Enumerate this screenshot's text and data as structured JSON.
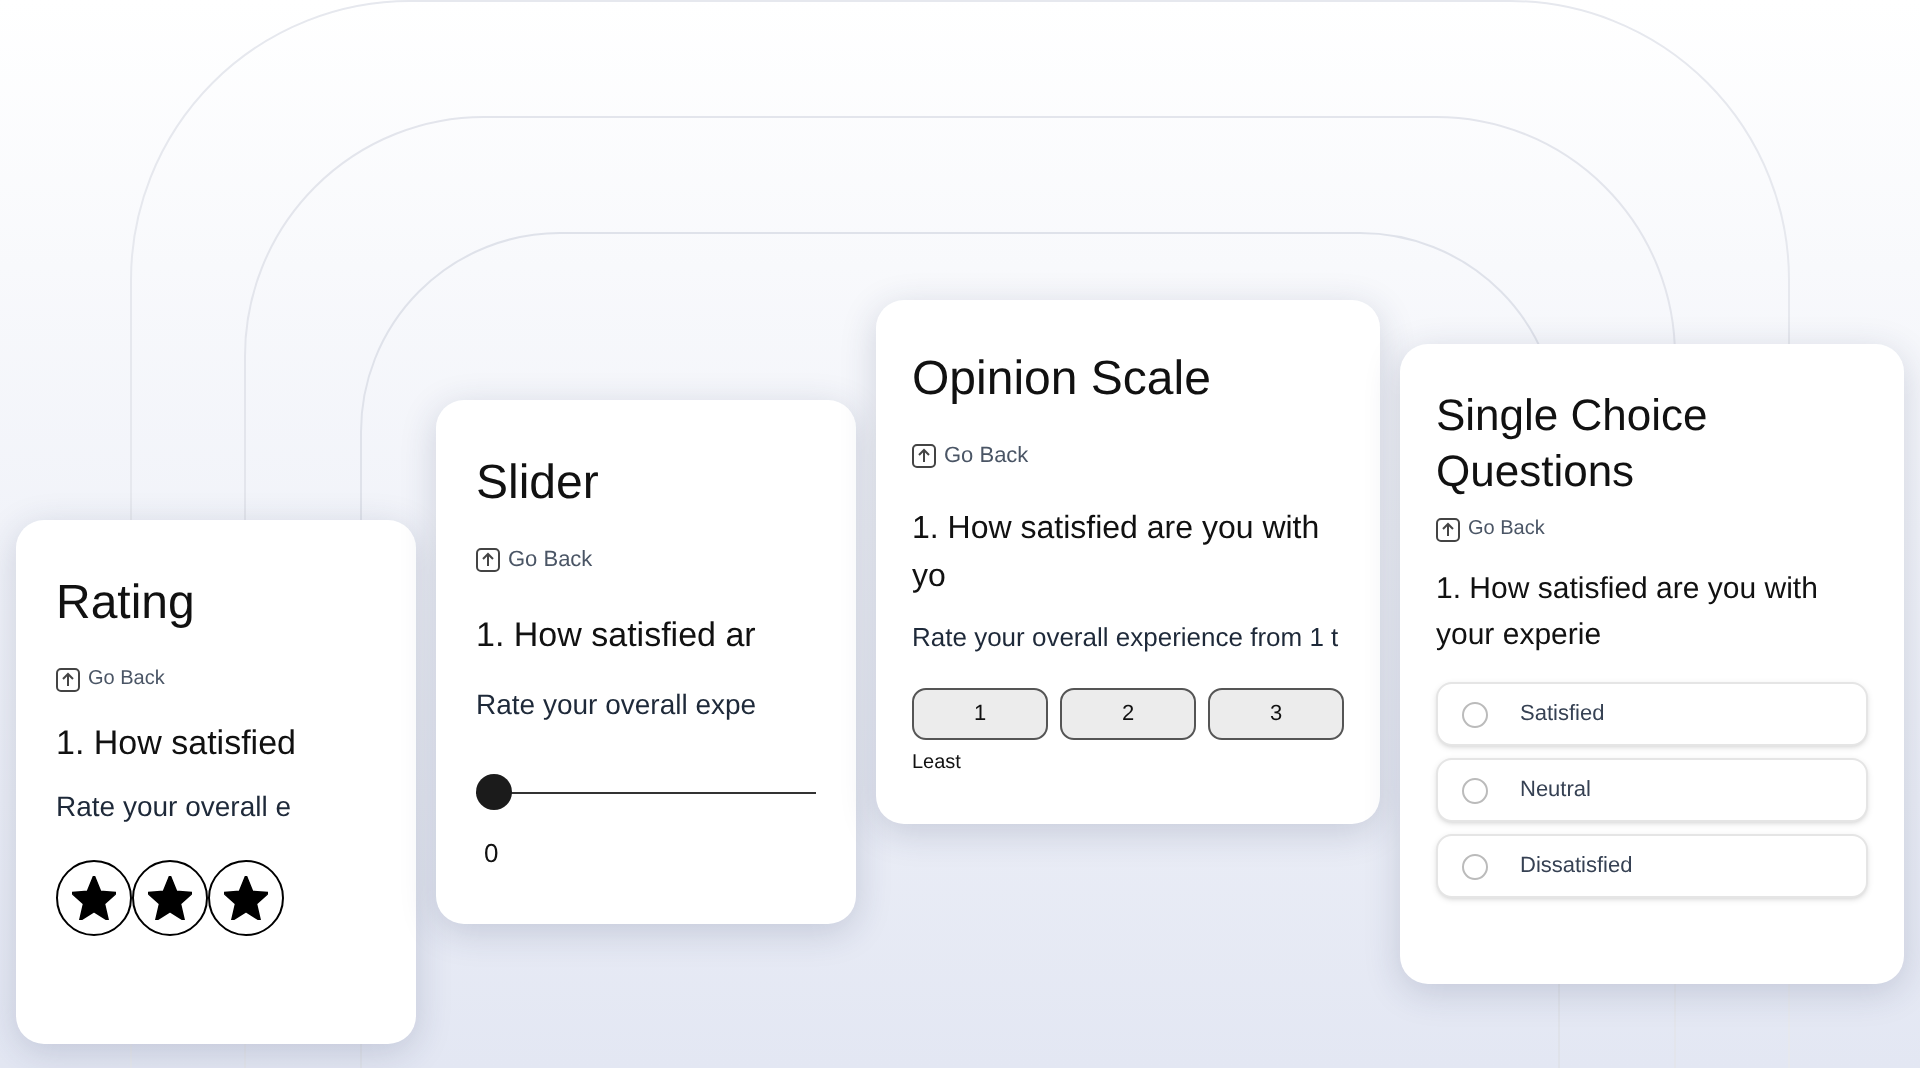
{
  "rating_card": {
    "title": "Rating",
    "go_back": "Go Back",
    "question": "1. How satisfied",
    "hint": "Rate your overall e",
    "stars": 3
  },
  "slider_card": {
    "title": "Slider",
    "go_back": "Go Back",
    "question": "1. How satisfied ar",
    "hint": "Rate your overall expe",
    "level": 0,
    "reading": "0"
  },
  "opinion_card": {
    "title": "Opinion Scale",
    "go_back": "Go Back",
    "question": "1. How satisfied are you with yo",
    "hint": "Rate your overall experience from 1 t",
    "options": [
      {
        "label": "1",
        "selected": false
      },
      {
        "label": "2",
        "selected": false
      },
      {
        "label": "3",
        "selected": false
      }
    ],
    "low_label": "Least"
  },
  "choice_card": {
    "title": "Single Choice Questions",
    "go_back": "Go Back",
    "question": "1. How satisfied are you with your experie",
    "options": [
      {
        "label": "Satisfied",
        "selected": false
      },
      {
        "label": "Neutral",
        "selected": false
      },
      {
        "label": "Dissatisfied",
        "selected": false
      }
    ]
  }
}
